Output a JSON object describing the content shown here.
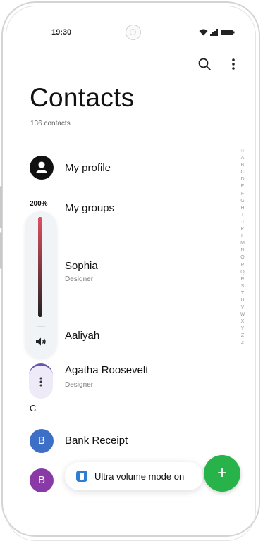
{
  "status_bar": {
    "time": "19:30"
  },
  "header": {
    "title": "Contacts",
    "count_text": "136 contacts"
  },
  "toolbar": {
    "search_icon": "search-icon",
    "more_icon": "more-vertical-icon"
  },
  "rows": [
    {
      "label": "My profile"
    },
    {
      "label": "My groups"
    },
    {
      "label": "Sophia",
      "sub": "Designer"
    },
    {
      "label": "Aaliyah"
    },
    {
      "label": "Agatha Roosevelt",
      "sub": "Designer"
    }
  ],
  "section_header": "C",
  "contacts_c": [
    {
      "initial": "B",
      "label": "Bank Receipt",
      "color": "#3d6fc6"
    },
    {
      "initial": "B",
      "color": "#8a3aa6"
    }
  ],
  "index_letters": [
    "☆",
    "A",
    "B",
    "C",
    "D",
    "E",
    "F",
    "G",
    "H",
    "I",
    "J",
    "K",
    "L",
    "M",
    "N",
    "O",
    "P",
    "Q",
    "R",
    "S",
    "T",
    "U",
    "V",
    "W",
    "X",
    "Y",
    "Z",
    "#"
  ],
  "volume": {
    "percent_text": "200%",
    "level": 1.0
  },
  "toast": {
    "text": "Ultra volume mode on"
  },
  "fab": {
    "symbol": "+"
  },
  "colors": {
    "fab": "#27b24a",
    "profile_avatar": "#111111"
  }
}
